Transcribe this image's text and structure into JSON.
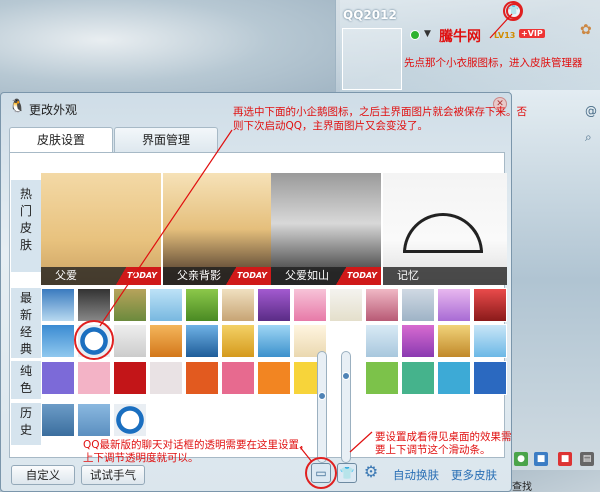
{
  "qq_panel": {
    "title": "QQ2012",
    "nickname": "騰牛网",
    "level": "LV13",
    "vip": "+VIP",
    "note": "先点那个小衣服图标，进入皮肤管理器",
    "skin_icon": "shirt-icon"
  },
  "dialog": {
    "title": "更改外观",
    "tabs": [
      "皮肤设置",
      "界面管理"
    ],
    "annotation_top": "再选中下面的小企鹅图标，之后主界面图片就会被保存下来。否则下次启动QQ，主界面图片又会变没了。",
    "sections": {
      "hot": "热门皮肤",
      "latest": "最新经典",
      "solid": "纯色",
      "history": "历史"
    },
    "hot_skins": [
      {
        "name": "父爱",
        "today": "TODAY"
      },
      {
        "name": "父亲背影",
        "today": "TODAY"
      },
      {
        "name": "父爱如山",
        "today": "TODAY"
      },
      {
        "name": "记忆",
        "today": ""
      }
    ],
    "buttons": {
      "custom": "自定义",
      "try": "试试手气",
      "auto_change": "自动换肤",
      "more_skins": "更多皮肤"
    },
    "annotation_bottom_left": "QQ最新版的聊天对话框的透明需要在这里设置，上下调节透明度就可以。",
    "annotation_bottom_right": "要设置成看得见桌面的效果需要上下调节这个滑动条。"
  },
  "taskbar": {
    "search_text": "查找"
  },
  "colors": {
    "annotation_red": "#e01010",
    "link_blue": "#2a6fb5"
  }
}
